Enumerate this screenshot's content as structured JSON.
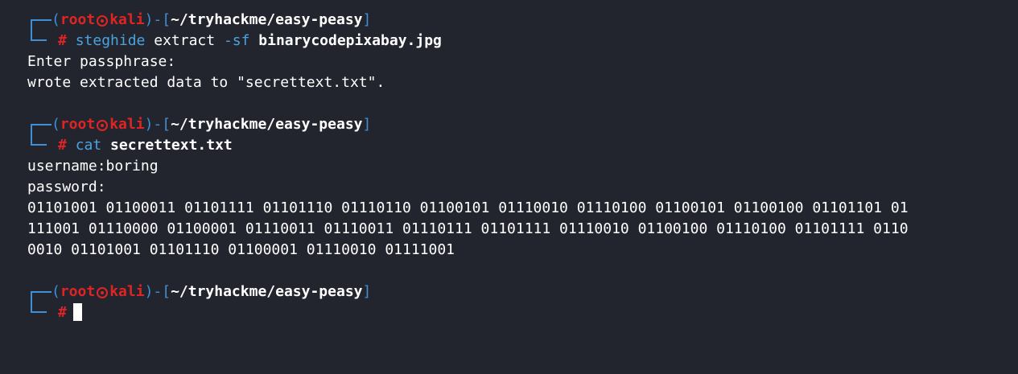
{
  "theme": {
    "background": "#23252e",
    "prompt_bracket_color": "#3f8fd6",
    "prompt_user_color": "#e02424",
    "command_color": "#4aa3df",
    "text_color": "#ffffff"
  },
  "prompt": {
    "user": "root",
    "host": "kali",
    "dir": "~/tryhackme/easy-peasy",
    "symbol": "#",
    "host_separator_icon": "kali-skull-icon"
  },
  "blocks": [
    {
      "command": "steghide",
      "args_plain": "extract",
      "args_flag": "-sf",
      "args_bold": "binarycodepixabay.jpg",
      "output": [
        "Enter passphrase:",
        "wrote extracted data to \"secrettext.txt\"."
      ]
    },
    {
      "command": "cat",
      "args_plain": "",
      "args_flag": "",
      "args_bold": "secrettext.txt",
      "output": [
        "username:boring",
        "password:",
        "01101001 01100011 01101111 01101110 01110110 01100101 01110010 01110100 01100101 01100100 01101101 01",
        "111001 01110000 01100001 01110011 01110011 01110111 01101111 01110010 01100100 01110100 01101111 0110",
        "0010 01101001 01101110 01100001 01110010 01111001"
      ]
    }
  ]
}
